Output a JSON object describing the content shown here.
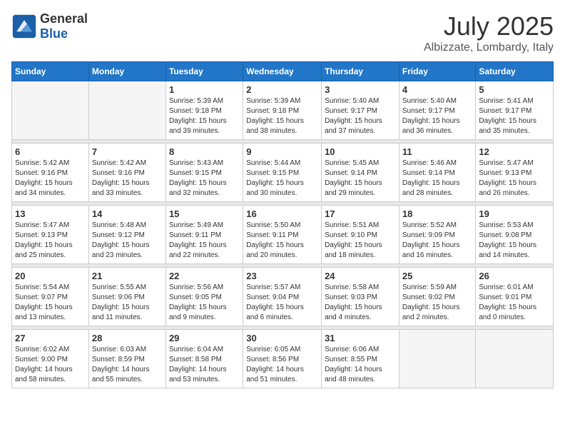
{
  "header": {
    "logo_general": "General",
    "logo_blue": "Blue",
    "month": "July 2025",
    "location": "Albizzate, Lombardy, Italy"
  },
  "days_of_week": [
    "Sunday",
    "Monday",
    "Tuesday",
    "Wednesday",
    "Thursday",
    "Friday",
    "Saturday"
  ],
  "weeks": [
    [
      {
        "day": "",
        "info": ""
      },
      {
        "day": "",
        "info": ""
      },
      {
        "day": "1",
        "info": "Sunrise: 5:39 AM\nSunset: 9:18 PM\nDaylight: 15 hours\nand 39 minutes."
      },
      {
        "day": "2",
        "info": "Sunrise: 5:39 AM\nSunset: 9:18 PM\nDaylight: 15 hours\nand 38 minutes."
      },
      {
        "day": "3",
        "info": "Sunrise: 5:40 AM\nSunset: 9:17 PM\nDaylight: 15 hours\nand 37 minutes."
      },
      {
        "day": "4",
        "info": "Sunrise: 5:40 AM\nSunset: 9:17 PM\nDaylight: 15 hours\nand 36 minutes."
      },
      {
        "day": "5",
        "info": "Sunrise: 5:41 AM\nSunset: 9:17 PM\nDaylight: 15 hours\nand 35 minutes."
      }
    ],
    [
      {
        "day": "6",
        "info": "Sunrise: 5:42 AM\nSunset: 9:16 PM\nDaylight: 15 hours\nand 34 minutes."
      },
      {
        "day": "7",
        "info": "Sunrise: 5:42 AM\nSunset: 9:16 PM\nDaylight: 15 hours\nand 33 minutes."
      },
      {
        "day": "8",
        "info": "Sunrise: 5:43 AM\nSunset: 9:15 PM\nDaylight: 15 hours\nand 32 minutes."
      },
      {
        "day": "9",
        "info": "Sunrise: 5:44 AM\nSunset: 9:15 PM\nDaylight: 15 hours\nand 30 minutes."
      },
      {
        "day": "10",
        "info": "Sunrise: 5:45 AM\nSunset: 9:14 PM\nDaylight: 15 hours\nand 29 minutes."
      },
      {
        "day": "11",
        "info": "Sunrise: 5:46 AM\nSunset: 9:14 PM\nDaylight: 15 hours\nand 28 minutes."
      },
      {
        "day": "12",
        "info": "Sunrise: 5:47 AM\nSunset: 9:13 PM\nDaylight: 15 hours\nand 26 minutes."
      }
    ],
    [
      {
        "day": "13",
        "info": "Sunrise: 5:47 AM\nSunset: 9:13 PM\nDaylight: 15 hours\nand 25 minutes."
      },
      {
        "day": "14",
        "info": "Sunrise: 5:48 AM\nSunset: 9:12 PM\nDaylight: 15 hours\nand 23 minutes."
      },
      {
        "day": "15",
        "info": "Sunrise: 5:49 AM\nSunset: 9:11 PM\nDaylight: 15 hours\nand 22 minutes."
      },
      {
        "day": "16",
        "info": "Sunrise: 5:50 AM\nSunset: 9:11 PM\nDaylight: 15 hours\nand 20 minutes."
      },
      {
        "day": "17",
        "info": "Sunrise: 5:51 AM\nSunset: 9:10 PM\nDaylight: 15 hours\nand 18 minutes."
      },
      {
        "day": "18",
        "info": "Sunrise: 5:52 AM\nSunset: 9:09 PM\nDaylight: 15 hours\nand 16 minutes."
      },
      {
        "day": "19",
        "info": "Sunrise: 5:53 AM\nSunset: 9:08 PM\nDaylight: 15 hours\nand 14 minutes."
      }
    ],
    [
      {
        "day": "20",
        "info": "Sunrise: 5:54 AM\nSunset: 9:07 PM\nDaylight: 15 hours\nand 13 minutes."
      },
      {
        "day": "21",
        "info": "Sunrise: 5:55 AM\nSunset: 9:06 PM\nDaylight: 15 hours\nand 11 minutes."
      },
      {
        "day": "22",
        "info": "Sunrise: 5:56 AM\nSunset: 9:05 PM\nDaylight: 15 hours\nand 9 minutes."
      },
      {
        "day": "23",
        "info": "Sunrise: 5:57 AM\nSunset: 9:04 PM\nDaylight: 15 hours\nand 6 minutes."
      },
      {
        "day": "24",
        "info": "Sunrise: 5:58 AM\nSunset: 9:03 PM\nDaylight: 15 hours\nand 4 minutes."
      },
      {
        "day": "25",
        "info": "Sunrise: 5:59 AM\nSunset: 9:02 PM\nDaylight: 15 hours\nand 2 minutes."
      },
      {
        "day": "26",
        "info": "Sunrise: 6:01 AM\nSunset: 9:01 PM\nDaylight: 15 hours\nand 0 minutes."
      }
    ],
    [
      {
        "day": "27",
        "info": "Sunrise: 6:02 AM\nSunset: 9:00 PM\nDaylight: 14 hours\nand 58 minutes."
      },
      {
        "day": "28",
        "info": "Sunrise: 6:03 AM\nSunset: 8:59 PM\nDaylight: 14 hours\nand 55 minutes."
      },
      {
        "day": "29",
        "info": "Sunrise: 6:04 AM\nSunset: 8:58 PM\nDaylight: 14 hours\nand 53 minutes."
      },
      {
        "day": "30",
        "info": "Sunrise: 6:05 AM\nSunset: 8:56 PM\nDaylight: 14 hours\nand 51 minutes."
      },
      {
        "day": "31",
        "info": "Sunrise: 6:06 AM\nSunset: 8:55 PM\nDaylight: 14 hours\nand 48 minutes."
      },
      {
        "day": "",
        "info": ""
      },
      {
        "day": "",
        "info": ""
      }
    ]
  ]
}
